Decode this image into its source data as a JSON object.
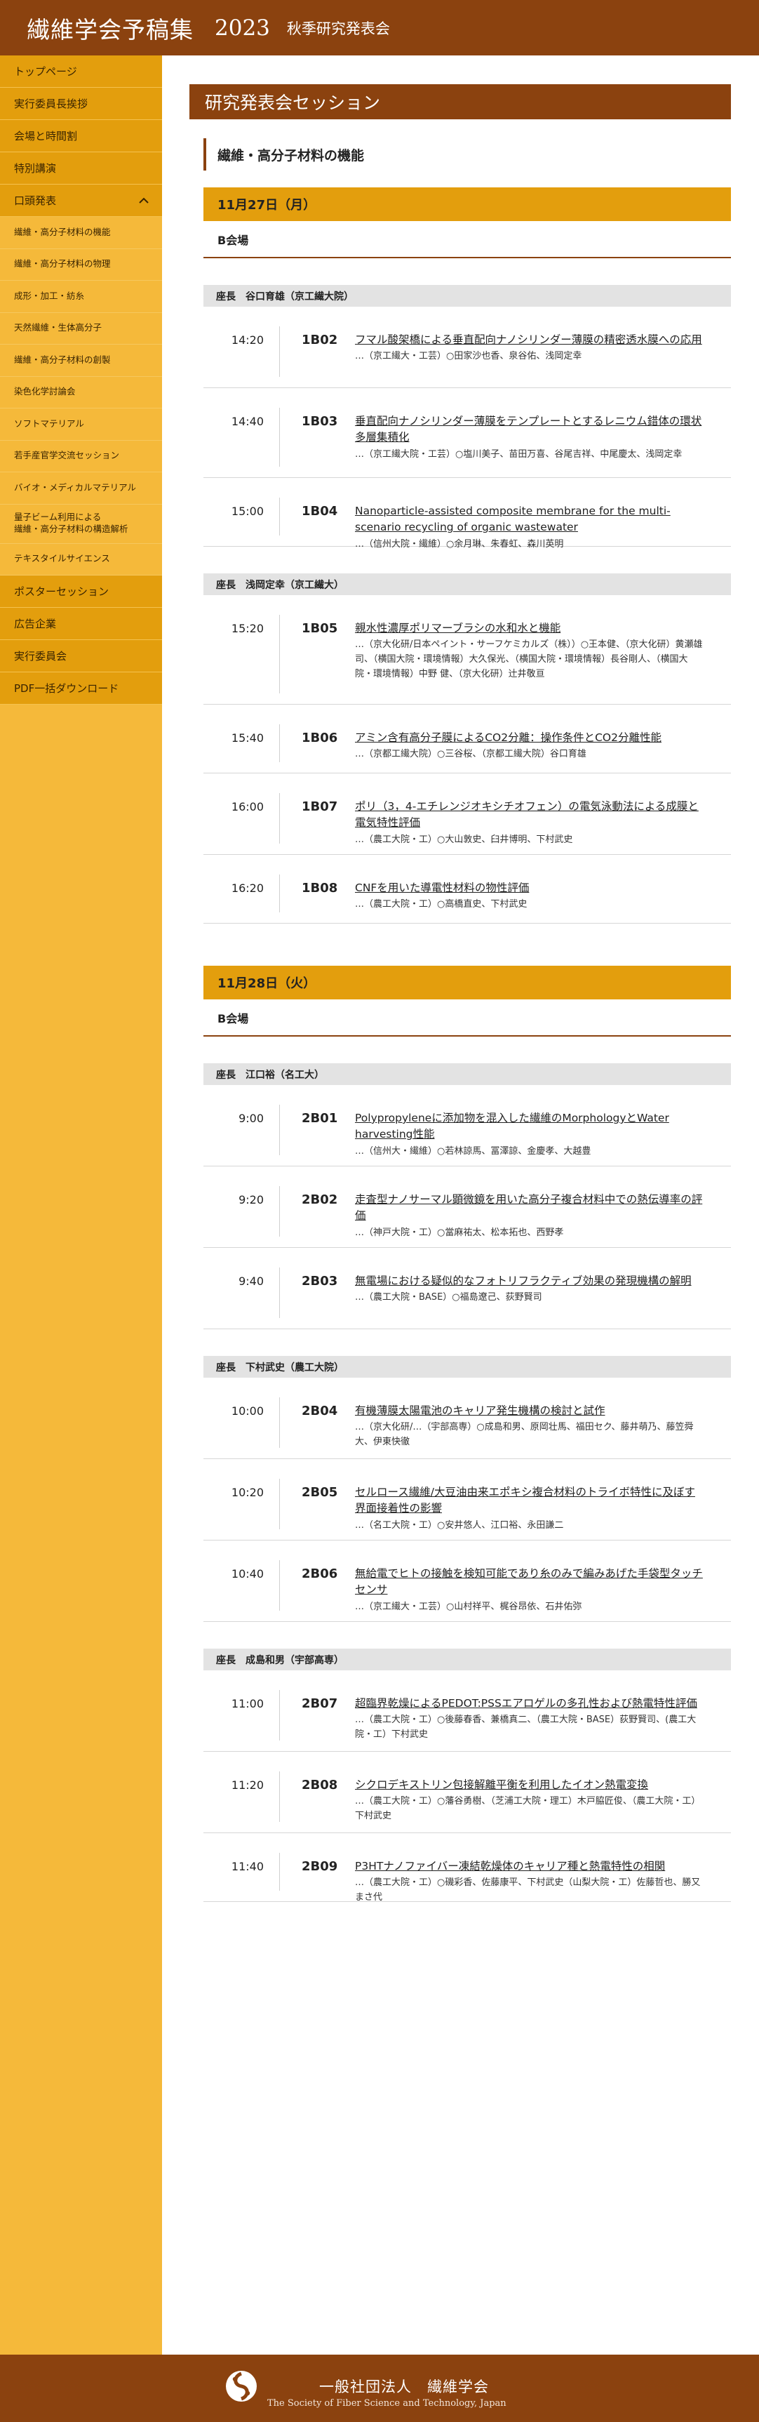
{
  "header": {
    "title": "繊維学会予稿集",
    "year": "2023",
    "subtitle": "秋季研究発表会"
  },
  "sidebar": {
    "items": [
      {
        "label": "トップページ",
        "level": 1
      },
      {
        "label": "実行委員長挨拶",
        "level": 1
      },
      {
        "label": "会場と時間割",
        "level": 1
      },
      {
        "label": "特別講演",
        "level": 1
      },
      {
        "label": "口頭発表",
        "level": 1,
        "expanded": true
      },
      {
        "label": "繊維・高分子材料の機能",
        "level": 2
      },
      {
        "label": "繊維・高分子材料の物理",
        "level": 2
      },
      {
        "label": "成形・加工・紡糸",
        "level": 2
      },
      {
        "label": "天然繊維・生体高分子",
        "level": 2
      },
      {
        "label": "繊維・高分子材料の創製",
        "level": 2
      },
      {
        "label": "染色化学討論会",
        "level": 2
      },
      {
        "label": "ソフトマテリアル",
        "level": 2
      },
      {
        "label": "若手産官学交流セッション",
        "level": 2
      },
      {
        "label": "バイオ・メディカルマテリアル",
        "level": 2
      },
      {
        "label": "量子ビーム利用による",
        "label2": "繊維・高分子材料の構造解析",
        "level": 2
      },
      {
        "label": "テキスタイルサイエンス",
        "level": 2
      },
      {
        "label": "ポスターセッション",
        "level": 1
      },
      {
        "label": "広告企業",
        "level": 1
      },
      {
        "label": "実行委員会",
        "level": 1
      },
      {
        "label": "PDF一括ダウンロード",
        "level": 1
      }
    ]
  },
  "main": {
    "heading": "研究発表会セッション",
    "session": "繊維・高分子材料の機能",
    "days": [
      {
        "date": "11月27日（月）",
        "room": "B会場",
        "groups": [
          {
            "chair": "座長　谷口育雄（京工繊大院）",
            "talks": [
              {
                "time": "14:20",
                "id": "1B02",
                "title": "フマル酸架橋による垂直配向ナノシリンダー薄膜の精密透水膜への応用",
                "authors": "…（京工繊大・工芸）○田家沙也香、泉谷佑、浅岡定幸"
              },
              {
                "time": "14:40",
                "id": "1B03",
                "title": "垂直配向ナノシリンダー薄膜をテンプレートとするレニウム錯体の環状多層集積化",
                "authors": "…（京工繊大院・工芸）○塩川美子、苗田万喜、谷尾吉祥、中尾慶太、浅岡定幸"
              },
              {
                "time": "15:00",
                "id": "1B04",
                "title": "Nanoparticle-assisted composite membrane for the multi-scenario recycling of organic wastewater",
                "authors": "…（信州大院・繊維）○余月琳、朱春虹、森川英明"
              }
            ]
          },
          {
            "chair": "座長　浅岡定幸（京工繊大）",
            "talks": [
              {
                "time": "15:20",
                "id": "1B05",
                "title": "親水性濃厚ポリマーブラシの水和水と機能",
                "authors": "…（京大化研/日本ペイント・サーフケミカルズ（株））○王本健、（京大化研）黄瀬雄司、（横国大院・環境情報）大久保光、（横国大院・環境情報）長谷剛人、（横国大院・環境情報）中野 健、（京大化研）辻井敬亘"
              },
              {
                "time": "15:40",
                "id": "1B06",
                "title": "アミン含有高分子膜によるCO2分離：操作条件とCO2分離性能",
                "authors": "…（京都工繊大院）○三谷桜、（京都工繊大院）谷口育雄"
              },
              {
                "time": "16:00",
                "id": "1B07",
                "title": "ポリ（3，4-エチレンジオキシチオフェン）の電気泳動法による成膜と電気特性評価",
                "authors": "…（農工大院・工）○大山敦史、臼井博明、下村武史"
              },
              {
                "time": "16:20",
                "id": "1B08",
                "title": "CNFを用いた導電性材料の物性評価",
                "authors": "…（農工大院・工）○高橋直史、下村武史"
              }
            ]
          }
        ]
      },
      {
        "date": "11月28日（火）",
        "room": "B会場",
        "groups": [
          {
            "chair": "座長　江口裕（名工大）",
            "talks": [
              {
                "time": "9:00",
                "id": "2B01",
                "title": "Polypropyleneに添加物を混入した繊維のMorphologyとWater harvesting性能",
                "authors": "…（信州大・繊維）○若林諒馬、冨澤諒、金慶孝、大越豊"
              },
              {
                "time": "9:20",
                "id": "2B02",
                "title": "走査型ナノサーマル顕微鏡を用いた高分子複合材料中での熱伝導率の評価",
                "authors": "…（神戸大院・工）○當麻祐太、松本拓也、西野孝"
              },
              {
                "time": "9:40",
                "id": "2B03",
                "title": "無電場における疑似的なフォトリフラクティブ効果の発現機構の解明",
                "authors": "…（農工大院・BASE）○福島遼己、荻野賢司"
              }
            ]
          },
          {
            "chair": "座長　下村武史（農工大院）",
            "talks": [
              {
                "time": "10:00",
                "id": "2B04",
                "title": "有機薄膜太陽電池のキャリア発生機構の検討と試作",
                "authors": "…（京大化研/…（宇部高専）○成島和男、原岡壮馬、福田セク、藤井萌乃、藤笠舜大、伊東快徹"
              },
              {
                "time": "10:20",
                "id": "2B05",
                "title": "セルロース繊維/大豆油由来エポキシ複合材料のトライボ特性に及ぼす界面接着性の影響",
                "authors": "…（名工大院・工）○安井悠人、江口裕、永田謙二"
              },
              {
                "time": "10:40",
                "id": "2B06",
                "title": "無給電でヒトの接触を検知可能であり糸のみで編みあげた手袋型タッチセンサ",
                "authors": "…（京工繊大・工芸）○山村祥平、梶谷昂依、石井佑弥"
              }
            ]
          },
          {
            "chair": "座長　成島和男（宇部高専）",
            "talks": [
              {
                "time": "11:00",
                "id": "2B07",
                "title": "超臨界乾燥によるPEDOT:PSSエアロゲルの多孔性および熱電特性評価",
                "authors": "…（農工大院・工）○後藤春香、兼橋真二、（農工大院・BASE）荻野賢司、(農工大院・工）下村武史"
              },
              {
                "time": "11:20",
                "id": "2B08",
                "title": "シクロデキストリン包接解離平衡を利用したイオン熱電変換",
                "authors": "…（農工大院・工）○藩谷勇樹、（芝浦工大院・理工）木戸脇匠俊、（農工大院・工）下村武史"
              },
              {
                "time": "11:40",
                "id": "2B09",
                "title": "P3HTナノファイバー凍結乾燥体のキャリア種と熱電特性の相関",
                "authors": "…（農工大院・工）○磯彩香、佐藤康平、下村武史（山梨大院・工）佐藤哲也、勝又まさ代"
              }
            ]
          }
        ]
      }
    ]
  },
  "footer": {
    "org_name": "一般社団法人　繊維学会",
    "org_en": "The Society of Fiber Science and Technology, Japan",
    "logo_icon": "society-logo-icon"
  }
}
